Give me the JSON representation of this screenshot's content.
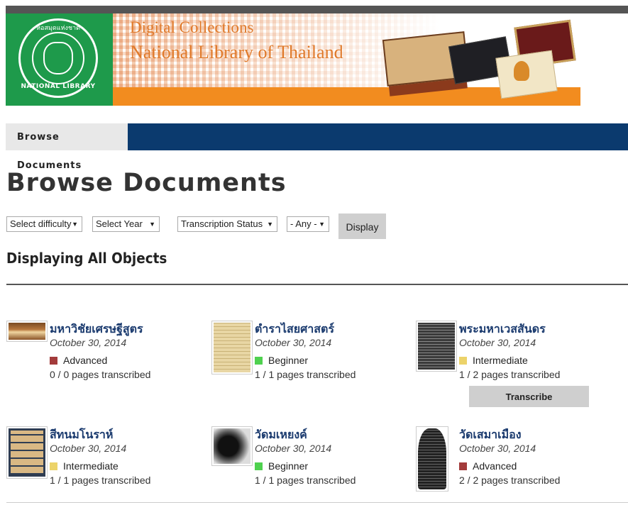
{
  "banner": {
    "line1": "Digital Collections",
    "line2": "National Library of Thailand",
    "seal_text_top": "หอสมุดแห่งชาติ",
    "seal_text_bottom": "NATIONAL LIBRARY",
    "colors": {
      "green": "#1e9a4b",
      "orange": "#f28c1f",
      "title": "#e07a2b"
    }
  },
  "nav": {
    "tab_label": "Browse Documents",
    "bar_color": "#0b3a6e"
  },
  "page": {
    "title": "Browse Documents",
    "subtitle": "Displaying All Objects"
  },
  "filters": {
    "difficulty": "Select difficulty",
    "year": "Select Year",
    "status": "Transcription Status",
    "any": "- Any -",
    "display_label": "Display"
  },
  "items": [
    {
      "title": "มหาวิชัยเศรษฐีสูตร",
      "date": "October 30, 2014",
      "difficulty": "Advanced",
      "difficulty_color": "#a33b3b",
      "pages": "0 / 0 pages transcribed"
    },
    {
      "title": "ตำราไสยศาสตร์",
      "date": "October 30, 2014",
      "difficulty": "Beginner",
      "difficulty_color": "#4fd14f",
      "pages": "1 / 1 pages transcribed"
    },
    {
      "title": "พระมหาเวสสันดร",
      "date": "October 30, 2014",
      "difficulty": "Intermediate",
      "difficulty_color": "#ecd36a",
      "pages": "1 / 2 pages transcribed",
      "button": "Transcribe"
    },
    {
      "title": "สีทนมโนราห์",
      "date": "October 30, 2014",
      "difficulty": "Intermediate",
      "difficulty_color": "#ecd36a",
      "pages": "1 / 1 pages transcribed"
    },
    {
      "title": "วัดมเหยงค์",
      "date": "October 30, 2014",
      "difficulty": "Beginner",
      "difficulty_color": "#4fd14f",
      "pages": "1 / 1 pages transcribed"
    },
    {
      "title": "วัดเสมาเมือง",
      "date": "October 30, 2014",
      "difficulty": "Advanced",
      "difficulty_color": "#a33b3b",
      "pages": "2 / 2 pages transcribed"
    }
  ]
}
